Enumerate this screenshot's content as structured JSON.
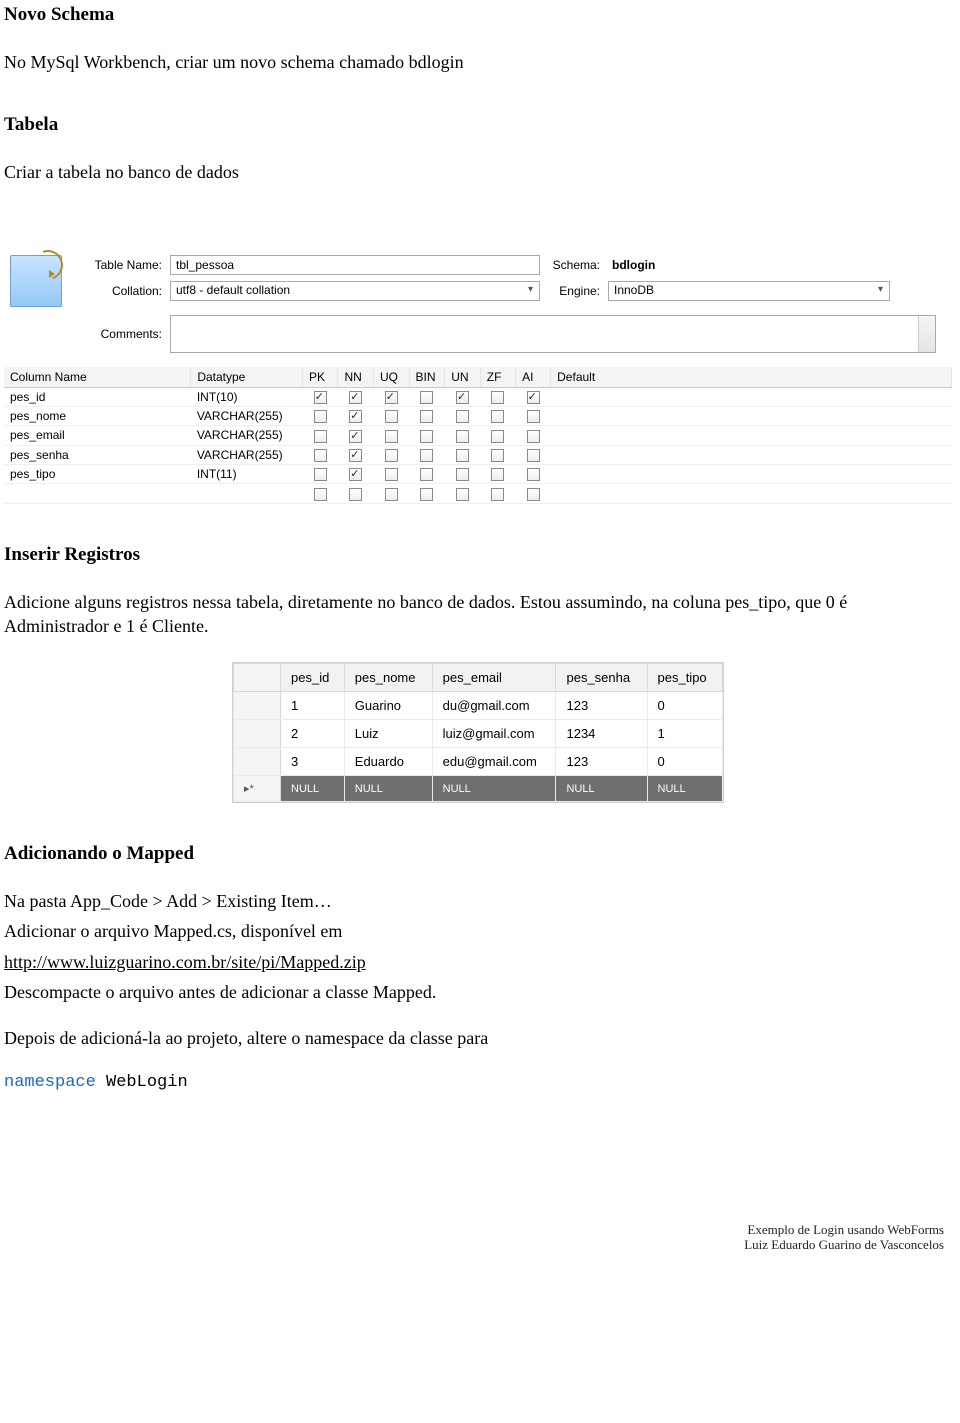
{
  "h_schema": "Novo Schema",
  "p_schema": "No MySql Workbench, criar um novo schema chamado bdlogin",
  "h_tabela": "Tabela",
  "p_tabela": "Criar a tabela no banco de dados",
  "wb": {
    "lbl_tablename": "Table Name:",
    "val_tablename": "tbl_pessoa",
    "lbl_schema": "Schema:",
    "val_schema": "bdlogin",
    "lbl_collation": "Collation:",
    "val_collation": "utf8 - default collation",
    "lbl_engine": "Engine:",
    "val_engine": "InnoDB",
    "lbl_comments": "Comments:",
    "headers": {
      "c0": "Column Name",
      "c1": "Datatype",
      "c2": "PK",
      "c3": "NN",
      "c4": "UQ",
      "c5": "BIN",
      "c6": "UN",
      "c7": "ZF",
      "c8": "AI",
      "c9": "Default"
    },
    "rows": [
      {
        "name": "pes_id",
        "dt": "INT(10)",
        "pk": true,
        "nn": true,
        "uq": true,
        "bin": false,
        "un": true,
        "zf": false,
        "ai": true
      },
      {
        "name": "pes_nome",
        "dt": "VARCHAR(255)",
        "pk": false,
        "nn": true,
        "uq": false,
        "bin": false,
        "un": false,
        "zf": false,
        "ai": false
      },
      {
        "name": "pes_email",
        "dt": "VARCHAR(255)",
        "pk": false,
        "nn": true,
        "uq": false,
        "bin": false,
        "un": false,
        "zf": false,
        "ai": false
      },
      {
        "name": "pes_senha",
        "dt": "VARCHAR(255)",
        "pk": false,
        "nn": true,
        "uq": false,
        "bin": false,
        "un": false,
        "zf": false,
        "ai": false
      },
      {
        "name": "pes_tipo",
        "dt": "INT(11)",
        "pk": false,
        "nn": true,
        "uq": false,
        "bin": false,
        "un": false,
        "zf": false,
        "ai": false
      }
    ]
  },
  "h_inserir": "Inserir Registros",
  "p_inserir": "Adicione alguns registros nessa tabela, diretamente no banco de dados. Estou assumindo, na coluna pes_tipo, que 0 é Administrador e 1 é Cliente.",
  "dg": {
    "headers": {
      "c0": "pes_id",
      "c1": "pes_nome",
      "c2": "pes_email",
      "c3": "pes_senha",
      "c4": "pes_tipo"
    },
    "rows": [
      {
        "id": "1",
        "nome": "Guarino",
        "email": "du@gmail.com",
        "senha": "123",
        "tipo": "0"
      },
      {
        "id": "2",
        "nome": "Luiz",
        "email": "luiz@gmail.com",
        "senha": "1234",
        "tipo": "1"
      },
      {
        "id": "3",
        "nome": "Eduardo",
        "email": "edu@gmail.com",
        "senha": "123",
        "tipo": "0"
      }
    ],
    "null_label": "NULL"
  },
  "h_mapped": "Adicionando o Mapped",
  "p_m1": "Na pasta App_Code > Add > Existing Item…",
  "p_m2": "Adicionar o arquivo Mapped.cs, disponível em",
  "link_mapped": "http://www.luizguarino.com.br/site/pi/Mapped.zip",
  "p_m3": "Descompacte o arquivo antes de adicionar a classe Mapped.",
  "p_m4": "Depois de adicioná-la ao projeto, altere o namespace da classe para",
  "code_kw": "namespace",
  "code_txt": " WebLogin",
  "footer1": "Exemplo de Login usando WebForms",
  "footer2": "Luiz Eduardo Guarino de Vasconcelos"
}
